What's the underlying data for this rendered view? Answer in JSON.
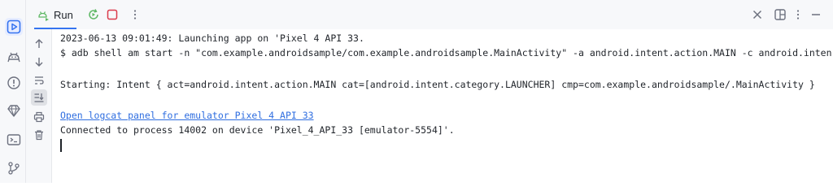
{
  "tab": {
    "label": "Run"
  },
  "console": {
    "lines": [
      "2023-06-13 09:01:49: Launching app on 'Pixel 4 API 33.",
      "$ adb shell am start -n \"com.example.androidsample/com.example.androidsample.MainActivity\" -a android.intent.action.MAIN -c android.inten",
      "Starting: Intent { act=android.intent.action.MAIN cat=[android.intent.category.LAUNCHER] cmp=com.example.androidsample/.MainActivity }",
      "Connected to process 14002 on device 'Pixel_4_API_33 [emulator-5554]'."
    ],
    "link": "Open logcat panel for emulator Pixel 4 API 33"
  },
  "colors": {
    "accent": "#3574f0",
    "stop_red": "#db3b4b",
    "run_green": "#5fb865",
    "link": "#2f6ee0"
  },
  "icons": {
    "left_strip": [
      "run-icon",
      "android-icon",
      "problems-icon",
      "gem-icon",
      "terminal-icon",
      "git-branch-icon"
    ],
    "toolbar": [
      "arrow-up-icon",
      "arrow-down-icon",
      "soft-wrap-icon",
      "scroll-to-end-icon",
      "print-icon",
      "trash-icon"
    ],
    "topbar": [
      "rerun-icon",
      "stop-icon",
      "more-vertical-icon",
      "close-icon",
      "layout-icon",
      "more-vertical-icon",
      "minimize-icon"
    ]
  }
}
